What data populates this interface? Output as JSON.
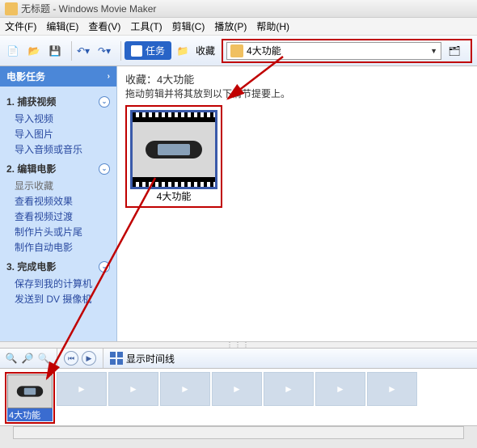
{
  "window": {
    "title": "无标题 - Windows Movie Maker"
  },
  "menu": {
    "file": "文件(F)",
    "edit": "编辑(E)",
    "view": "查看(V)",
    "tools": "工具(T)",
    "clip": "剪辑(C)",
    "play": "播放(P)",
    "help": "帮助(H)"
  },
  "toolbar": {
    "tasks_label": "任务",
    "collections_label": "收藏",
    "dropdown_value": "4大功能"
  },
  "sidebar": {
    "title": "电影任务",
    "sections": [
      {
        "num": "1.",
        "title": "捕获视频",
        "items": [
          "导入视频",
          "导入图片",
          "导入音频或音乐"
        ]
      },
      {
        "num": "2.",
        "title": "编辑电影",
        "sub": "显示收藏",
        "items": [
          "查看视频效果",
          "查看视频过渡",
          "制作片头或片尾",
          "制作自动电影"
        ]
      },
      {
        "num": "3.",
        "title": "完成电影",
        "items": [
          "保存到我的计算机",
          "发送到 DV 摄像机"
        ]
      }
    ]
  },
  "content": {
    "heading": "收藏：4大功能",
    "hint": "拖动剪辑并将其放到以下情节提要上。",
    "clip_label": "4大功能"
  },
  "controls": {
    "timeline_label": "显示时间线"
  },
  "timeline": {
    "selected_clip_label": "4大功能"
  }
}
